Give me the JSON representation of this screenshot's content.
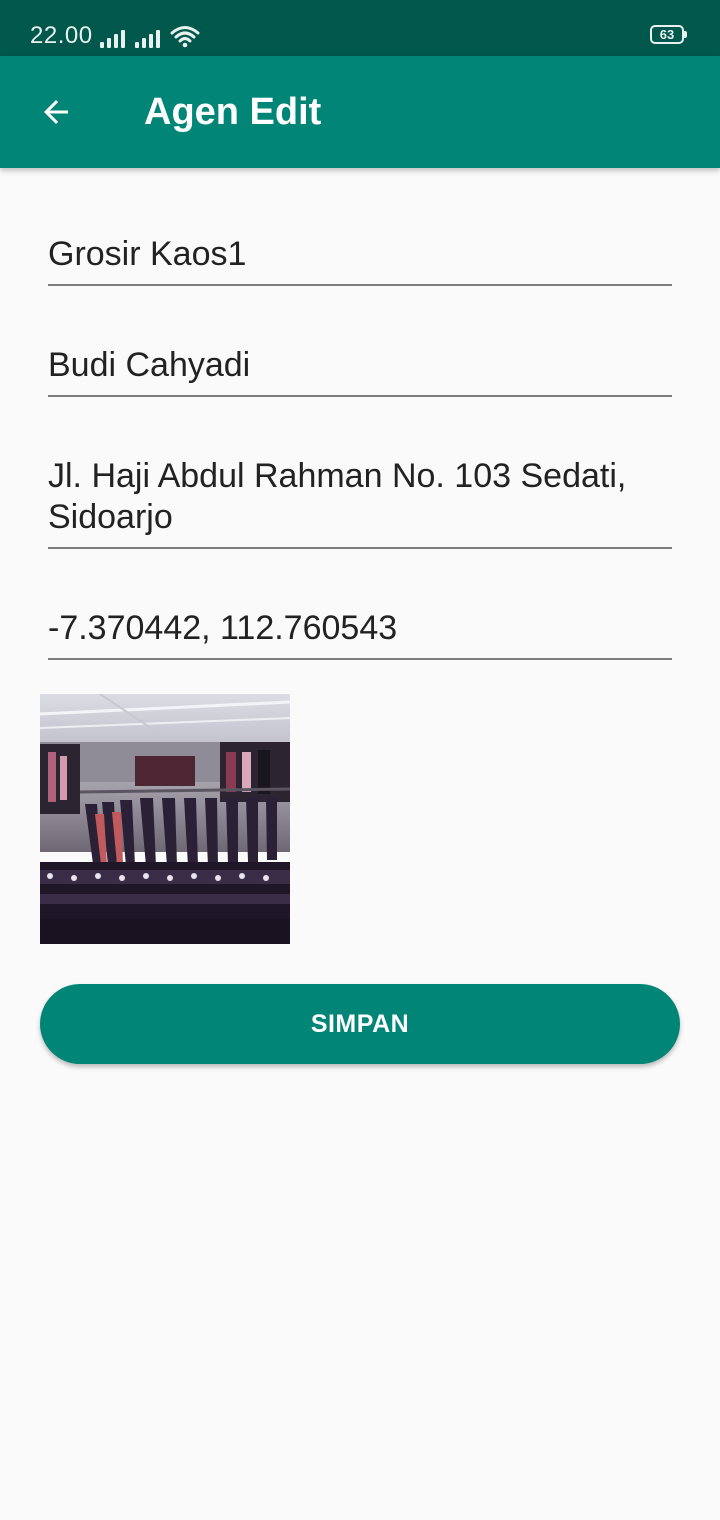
{
  "status_bar": {
    "time": "22.00",
    "battery": "63",
    "icons": [
      "signal-icon",
      "signal-icon",
      "wifi-icon",
      "battery-icon"
    ]
  },
  "app_bar": {
    "title": "Agen Edit",
    "back_icon": "arrow-back-icon"
  },
  "form": {
    "agent_name": "Grosir Kaos1",
    "owner_name": "Budi Cahyadi",
    "address": "Jl. Haji Abdul Rahman No. 103 Sedati, Sidoarjo",
    "coordinates": "-7.370442, 112.760543"
  },
  "save_button": {
    "label": "SIMPAN"
  },
  "colors": {
    "primary": "#008577",
    "primary_dark": "#00574b",
    "background": "#fafafa",
    "field_underline": "#7d7d7d"
  }
}
